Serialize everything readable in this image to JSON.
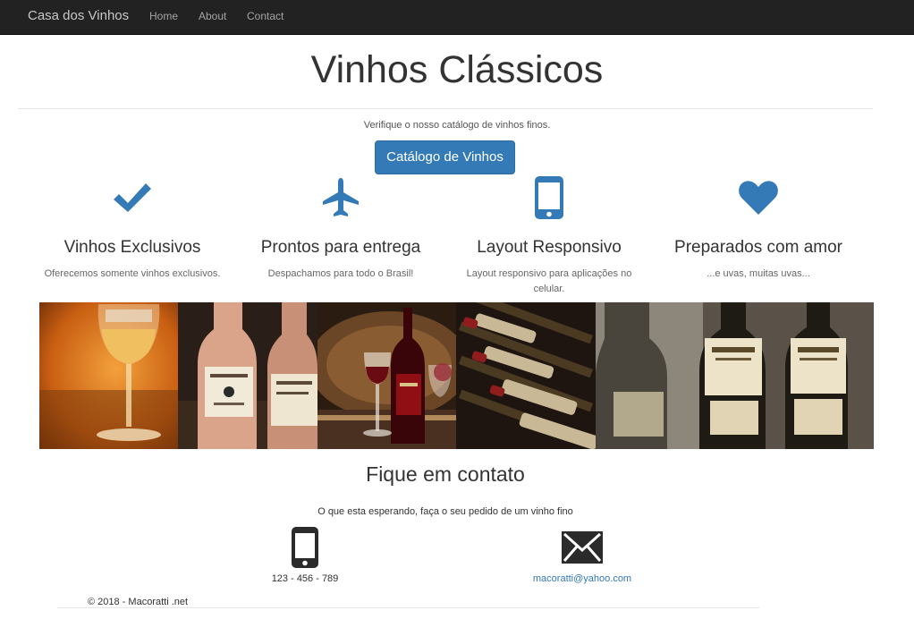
{
  "navbar": {
    "brand": "Casa dos Vinhos",
    "links": [
      "Home",
      "About",
      "Contact"
    ]
  },
  "hero": {
    "title": "Vinhos Clássicos",
    "lead": "Verifique o nosso catálogo de vinhos finos.",
    "button_label": "Catálogo de Vinhos"
  },
  "features": [
    {
      "icon": "checkmark-icon",
      "title": "Vinhos Exclusivos",
      "text": "Oferecemos somente vinhos exclusivos."
    },
    {
      "icon": "airplane-icon",
      "title": "Prontos para entrega",
      "text": "Despachamos para todo o Brasil!"
    },
    {
      "icon": "mobile-phone-icon",
      "title": "Layout Responsivo",
      "text": "Layout responsivo para aplicações no celular."
    },
    {
      "icon": "heart-icon",
      "title": "Preparados com amor",
      "text": "...e uvas, muitas uvas..."
    }
  ],
  "gallery": {
    "photos": [
      "wine-glass-photo",
      "rose-wine-bottles-photo",
      "red-wine-barrel-photo",
      "wine-rack-bottles-photo",
      "joullian-bottles-photo"
    ]
  },
  "contact": {
    "title": "Fique em contato",
    "lead": "O que esta esperando, faça o seu pedido de um vinho fino",
    "phone": "123 - 456 - 789",
    "email": "macoratti@yahoo.com"
  },
  "footer": {
    "text": "© 2018 - Macoratti .net"
  },
  "colors": {
    "accent": "#337ab7",
    "navbar": "#222222"
  }
}
